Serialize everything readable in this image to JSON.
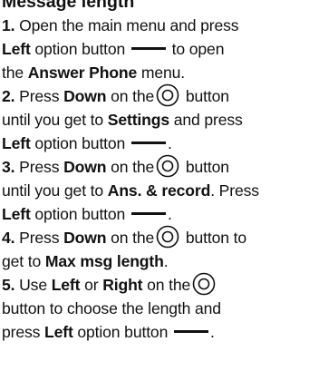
{
  "heading": "Message length",
  "icons": {
    "option_button": "horizontal-line-icon",
    "navigation_key": "navigation-key-icon"
  },
  "steps": [
    {
      "number": "1.",
      "t1": " Open the main menu and press",
      "left": "Left",
      "t2": " option button",
      "t3": " to open",
      "t4": "the ",
      "menu_name": "Answer Phone",
      "t5": " menu."
    },
    {
      "number": "2.",
      "t1": " Press ",
      "down": "Down",
      "t2": " on the",
      "t3": " button",
      "t4": "until you get to ",
      "settings": "Settings",
      "t5": " and press",
      "left": "Left",
      "t6": " option button",
      "t7": "."
    },
    {
      "number": "3.",
      "t1": " Press ",
      "down": "Down",
      "t2": " on the",
      "t3": " button",
      "t4": "until you get to ",
      "target": "Ans. & record",
      "t5": ". Press",
      "left": "Left",
      "t6": " option button",
      "t7": "."
    },
    {
      "number": "4.",
      "t1": " Press ",
      "down": "Down",
      "t2": " on the",
      "t3": " button to",
      "t4": "get to ",
      "target": "Max msg length",
      "t5": "."
    },
    {
      "number": "5.",
      "t1": " Use ",
      "left": "Left",
      "t2": " or ",
      "right": "Right",
      "t3": " on the",
      "t4": "button to choose the length and",
      "t5": "press ",
      "left2": "Left",
      "t6": " option button",
      "t7": "."
    }
  ]
}
